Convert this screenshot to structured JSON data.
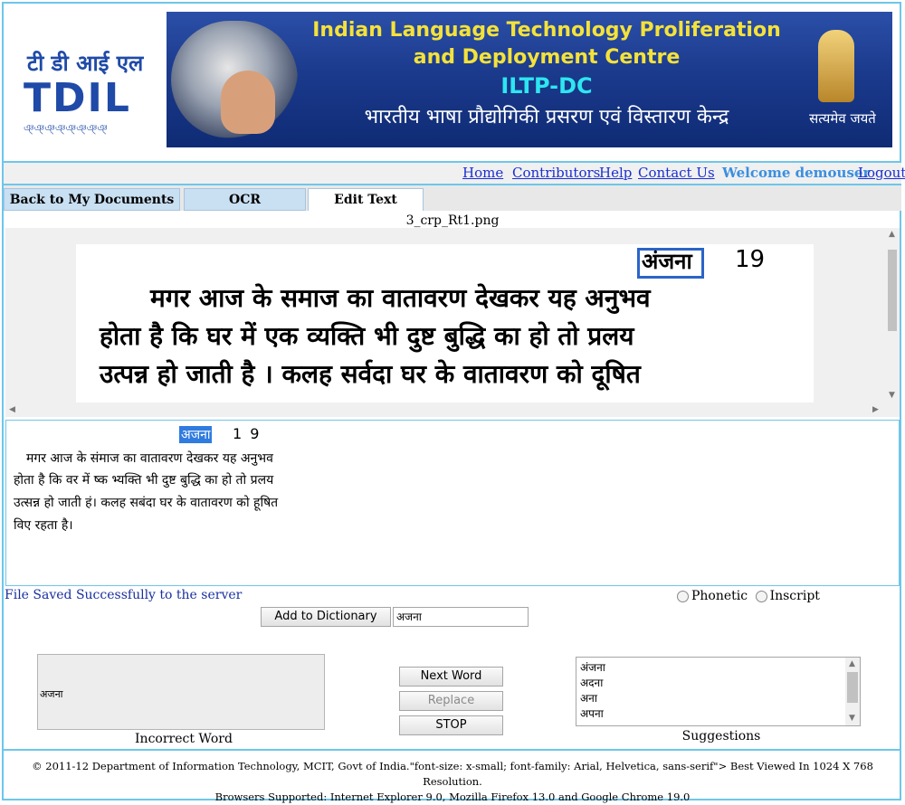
{
  "banner": {
    "logo_hindi": "टी डी आई एल",
    "logo_text": "TDIL",
    "logo_sub": "ঞ্ঞ্ঞ্ঞ্ঞ্ঞ্ঞ্ঞ্",
    "title_line1": "Indian Language Technology Proliferation",
    "title_line2": "and Deployment Centre",
    "title_abbr": "ILTP-DC",
    "title_hindi": "भारतीय भाषा प्रौद्योगिकी प्रसरण एवं विस्तारण केन्द्र",
    "motto": "सत्यमेव जयते"
  },
  "nav": {
    "home": "Home",
    "contributors": "Contributors",
    "help": "Help",
    "contact": "Contact Us",
    "welcome": "Welcome demouser",
    "logout": "Logout"
  },
  "tabs": {
    "back": "Back to My Documents",
    "ocr": "OCR",
    "edit": "Edit Text"
  },
  "file_name": "3_crp_Rt1.png",
  "scan": {
    "heading": "अंजना",
    "number": "19",
    "lines": [
      "मगर आज के समाज का  वातावरण  देखकर  यह अनुभव",
      "होता है कि घर में एक व्यक्ति भी  दुष्ट  बुद्धि  का हो  तो प्रलय",
      "उत्पन्न हो जाती है । कलह सर्वदा घर  के वातावरण  को दूषित"
    ]
  },
  "editor": {
    "highlight_word": "अजना",
    "number": "1 9",
    "lines": [
      "मगर आज के संमाज का वातावरण देखकर यह अनुभव",
      "होता है कि वर में ष्क भ्यक्ति भी दुष्ट बुद्धि का हो तो प्रलय",
      "उत्सन्न हो जाती हं। कलह सबंदा घर के वातावरण को हूषित",
      "विए रहता है।"
    ]
  },
  "status": {
    "saved": "File Saved Successfully to the server",
    "phonetic": "Phonetic",
    "inscript": "Inscript"
  },
  "dictionary": {
    "button": "Add to Dictionary",
    "value": "अजना"
  },
  "incorrect": {
    "word": "अजना",
    "label": "Incorrect Word"
  },
  "buttons": {
    "next": "Next Word",
    "replace": "Replace",
    "stop": "STOP"
  },
  "suggestions": {
    "items": [
      "अंजना",
      "अदना",
      "अना",
      "अपना"
    ],
    "label": "Suggestions"
  },
  "footer": {
    "line1": "© 2011-12 Department of Information Technology, MCIT, Govt of India.\"font-size: x-small; font-family: Arial, Helvetica, sans-serif\"> Best Viewed In 1024 X 768 Resolution.",
    "line2": "Browsers Supported: Internet Explorer 9.0, Mozilla Firefox 13.0 and Google Chrome 19.0"
  }
}
